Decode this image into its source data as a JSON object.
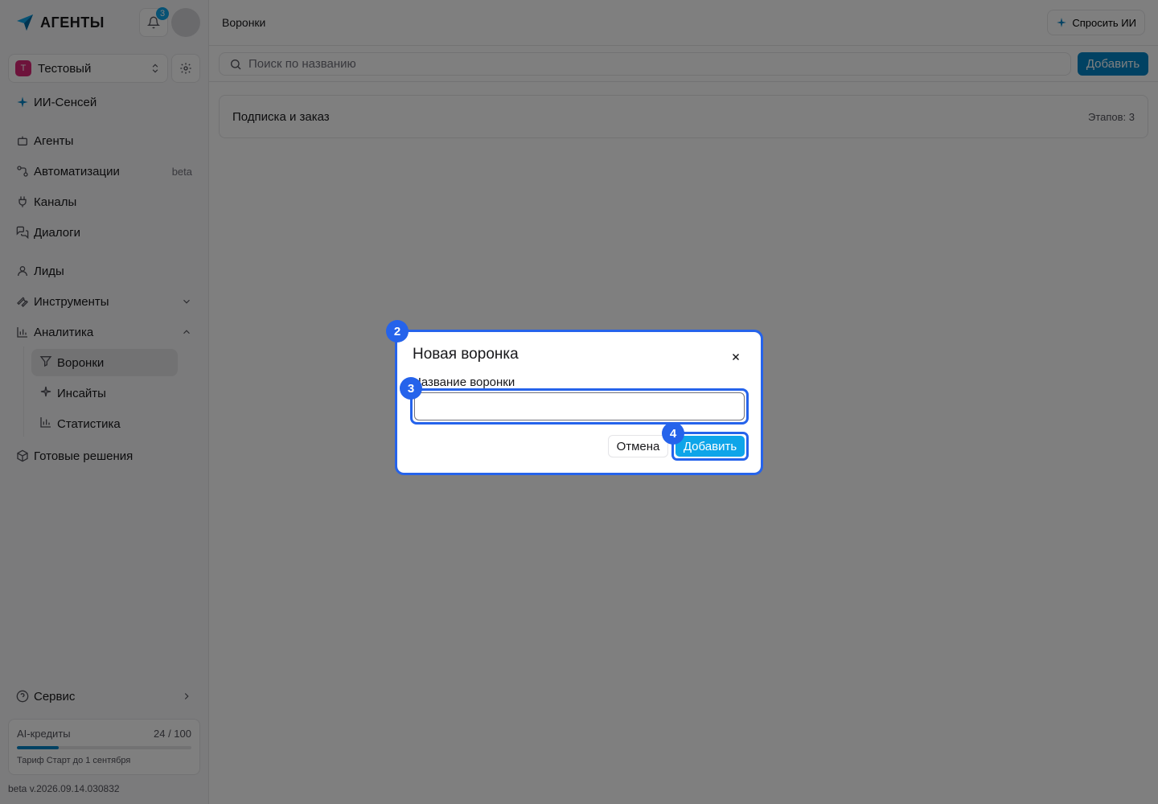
{
  "app": {
    "brand_name": "АГЕНТЫ",
    "notifications_count": "3",
    "version": "beta v.2026.09.14.030832"
  },
  "workspace": {
    "initial": "Т",
    "name": "Тестовый"
  },
  "sidebar": {
    "ai_sensei": "ИИ-Сенсей",
    "items": [
      {
        "label": "Агенты",
        "icon": "bot-icon"
      },
      {
        "label": "Автоматизации",
        "icon": "workflow-icon",
        "tag": "beta"
      },
      {
        "label": "Каналы",
        "icon": "plug-icon"
      },
      {
        "label": "Диалоги",
        "icon": "messages-icon"
      },
      {
        "label": "Лиды",
        "icon": "user-icon"
      },
      {
        "label": "Инструменты",
        "icon": "wrench-icon"
      },
      {
        "label": "Аналитика",
        "icon": "bar-chart-icon"
      }
    ],
    "analytics_sub": [
      {
        "label": "Воронки",
        "icon": "filter-icon",
        "active": true
      },
      {
        "label": "Инсайты",
        "icon": "sparkle-icon"
      },
      {
        "label": "Статистика",
        "icon": "chart-icon"
      }
    ],
    "solutions": "Готовые решения",
    "service": "Сервис"
  },
  "credits": {
    "label": "AI-кредиты",
    "value": "24 / 100",
    "progress": 0.24,
    "plan": "Тариф Старт до 1 сентября"
  },
  "header": {
    "title": "Воронки",
    "ask_ai": "Спросить ИИ"
  },
  "toolbar": {
    "search_placeholder": "Поиск по названию",
    "add_label": "Добавить"
  },
  "funnels": [
    {
      "name": "Подписка и заказ",
      "stages": "Этапов: 3"
    }
  ],
  "modal": {
    "title": "Новая воронка",
    "field_label": "Название воронки",
    "field_value": "",
    "cancel_label": "Отмена",
    "submit_label": "Добавить"
  },
  "markers": {
    "modal": "2",
    "field": "3",
    "submit": "4"
  },
  "colors": {
    "accent": "#0284c7",
    "highlight": "#2563eb",
    "workspace_badge": "#db2777"
  }
}
